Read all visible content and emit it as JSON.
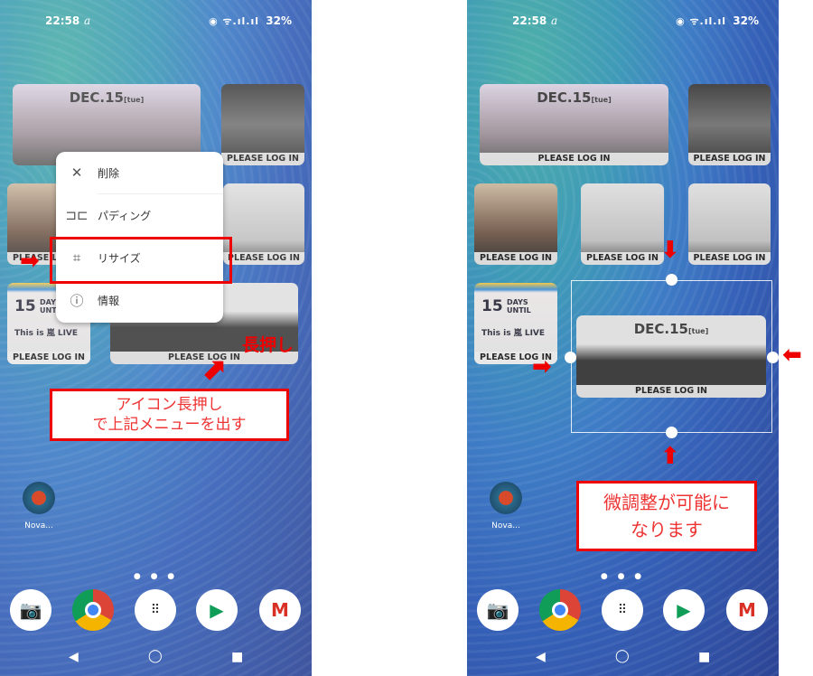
{
  "status": {
    "time": "22:58",
    "carrier_icon": "a",
    "signal_icons": "◉ ᯤ.ıl.ıl",
    "battery": "32%"
  },
  "widgets": {
    "date_title": "DEC.15",
    "date_day": "[tue]",
    "login": "PLEASE LOG IN",
    "countdown_number": "15",
    "countdown_days": "DAYS",
    "countdown_until": "UNTIL",
    "countdown_event": "This is 嵐 LIVE"
  },
  "menu": {
    "items": [
      {
        "icon": "close-icon",
        "label": "削除"
      },
      {
        "icon": "padding-icon",
        "label": "パディング"
      },
      {
        "icon": "crop-icon",
        "label": "リサイズ"
      },
      {
        "icon": "info-icon",
        "label": "情報"
      }
    ]
  },
  "annotations": {
    "long_press": "長押し",
    "left_note_line1": "アイコン長押し",
    "left_note_line2": "で上記メニューを出す",
    "right_note_line1": "微調整が可能に",
    "right_note_line2": "なります"
  },
  "app": {
    "nova_label": "Nova..."
  },
  "dock": [
    "camera",
    "chrome",
    "app-drawer",
    "play-store",
    "gmail"
  ],
  "colors": {
    "annotation_red": "#e00000"
  }
}
